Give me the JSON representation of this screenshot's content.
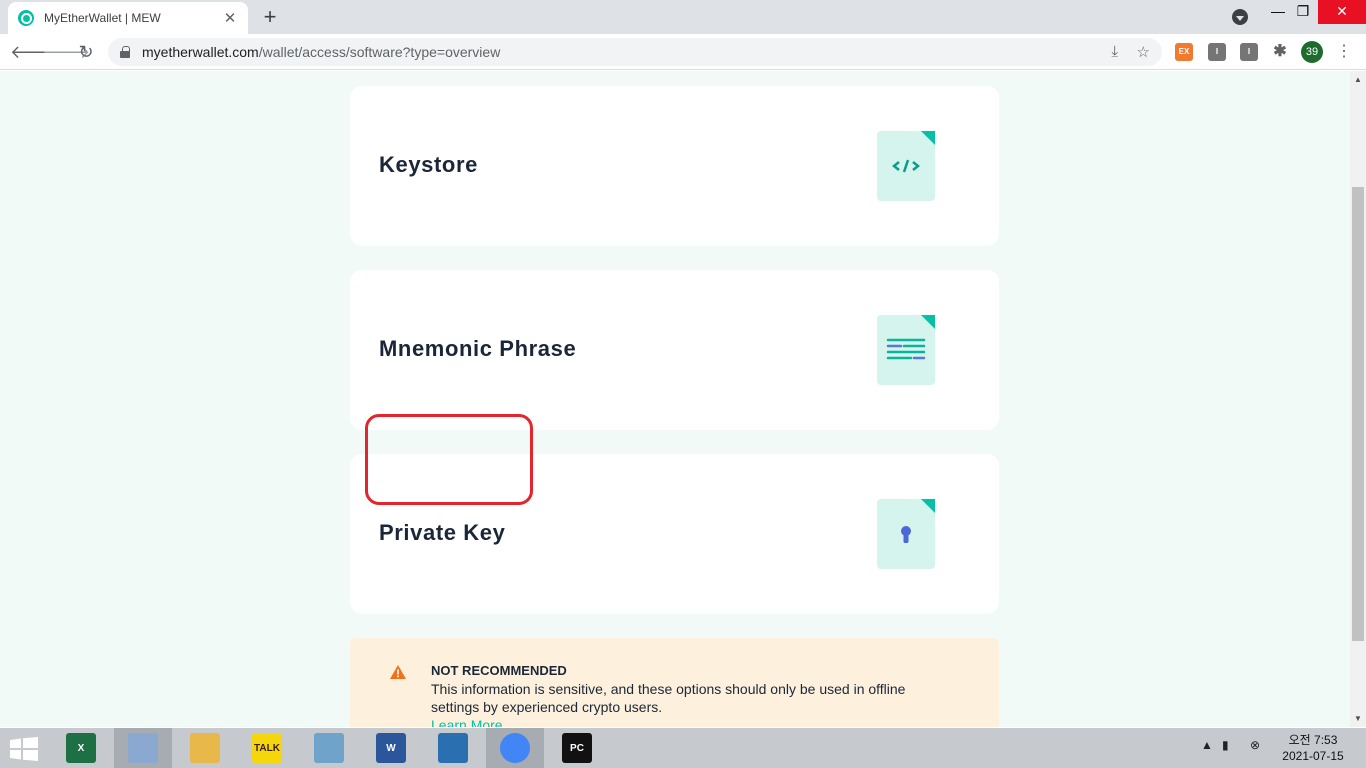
{
  "browser": {
    "tab_title": "MyEtherWallet | MEW",
    "tab_close": "✕",
    "new_tab": "+",
    "win_min": "—",
    "win_max": "❐",
    "win_close": "✕",
    "url_host": "myetherwallet.com",
    "url_path": "/wallet/access/software?type=overview",
    "profile_badge": "39",
    "extensions": [
      "EX",
      "I",
      "I"
    ]
  },
  "cards": [
    {
      "label": "Keystore",
      "icon": "code-file-icon"
    },
    {
      "label": "Mnemonic Phrase",
      "icon": "text-file-icon"
    },
    {
      "label": "Private Key",
      "icon": "keyhole-file-icon"
    }
  ],
  "warning": {
    "title": "NOT RECOMMENDED",
    "text": "This information is sensitive, and these options should only be used in offline settings by experienced crypto users.",
    "link": "Learn More"
  },
  "taskbar": {
    "apps": [
      {
        "name": "excel",
        "glyph": "X",
        "color": "#1d7044"
      },
      {
        "name": "paint",
        "glyph": "",
        "color": "#8aa8d0"
      },
      {
        "name": "file-explorer",
        "glyph": "",
        "color": "#e8b84a"
      },
      {
        "name": "kakaotalk",
        "glyph": "TALK",
        "color": "#f5d60a"
      },
      {
        "name": "notepad",
        "glyph": "",
        "color": "#6fa3c9"
      },
      {
        "name": "word",
        "glyph": "W",
        "color": "#2b579a"
      },
      {
        "name": "editor",
        "glyph": "",
        "color": "#2a6fb0"
      },
      {
        "name": "chrome",
        "glyph": "",
        "color": "#4285f4"
      },
      {
        "name": "pycharm",
        "glyph": "PC",
        "color": "#111111"
      }
    ],
    "clock_time": "오전 7:53",
    "clock_date": "2021-07-15"
  },
  "colors": {
    "accent": "#05c0a5",
    "highlight": "#e3262d",
    "warning_bg": "#fdf0dd"
  }
}
